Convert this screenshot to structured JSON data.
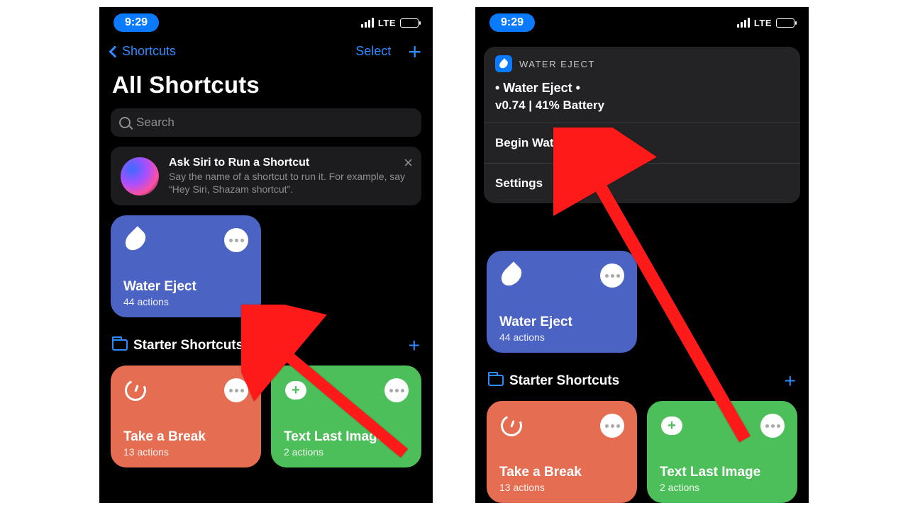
{
  "status": {
    "time": "9:29",
    "network": "LTE"
  },
  "nav": {
    "back_label": "Shortcuts",
    "select_label": "Select"
  },
  "title": "All Shortcuts",
  "search": {
    "placeholder": "Search"
  },
  "siri": {
    "title": "Ask Siri to Run a Shortcut",
    "body": "Say the name of a shortcut to run it. For example, say “Hey Siri, Shazam shortcut”."
  },
  "tiles": {
    "water": {
      "name": "Water Eject",
      "sub": "44 actions"
    },
    "break": {
      "name": "Take a Break",
      "sub": "13 actions"
    },
    "text": {
      "name": "Text Last Image",
      "sub": "2 actions"
    }
  },
  "section": {
    "label": "Starter Shortcuts"
  },
  "sheet": {
    "app": "WATER EJECT",
    "title": "• Water Eject •",
    "subtitle": "v0.74 | 41% Battery",
    "item1": "Begin Water Ejection",
    "item2": "Settings"
  }
}
